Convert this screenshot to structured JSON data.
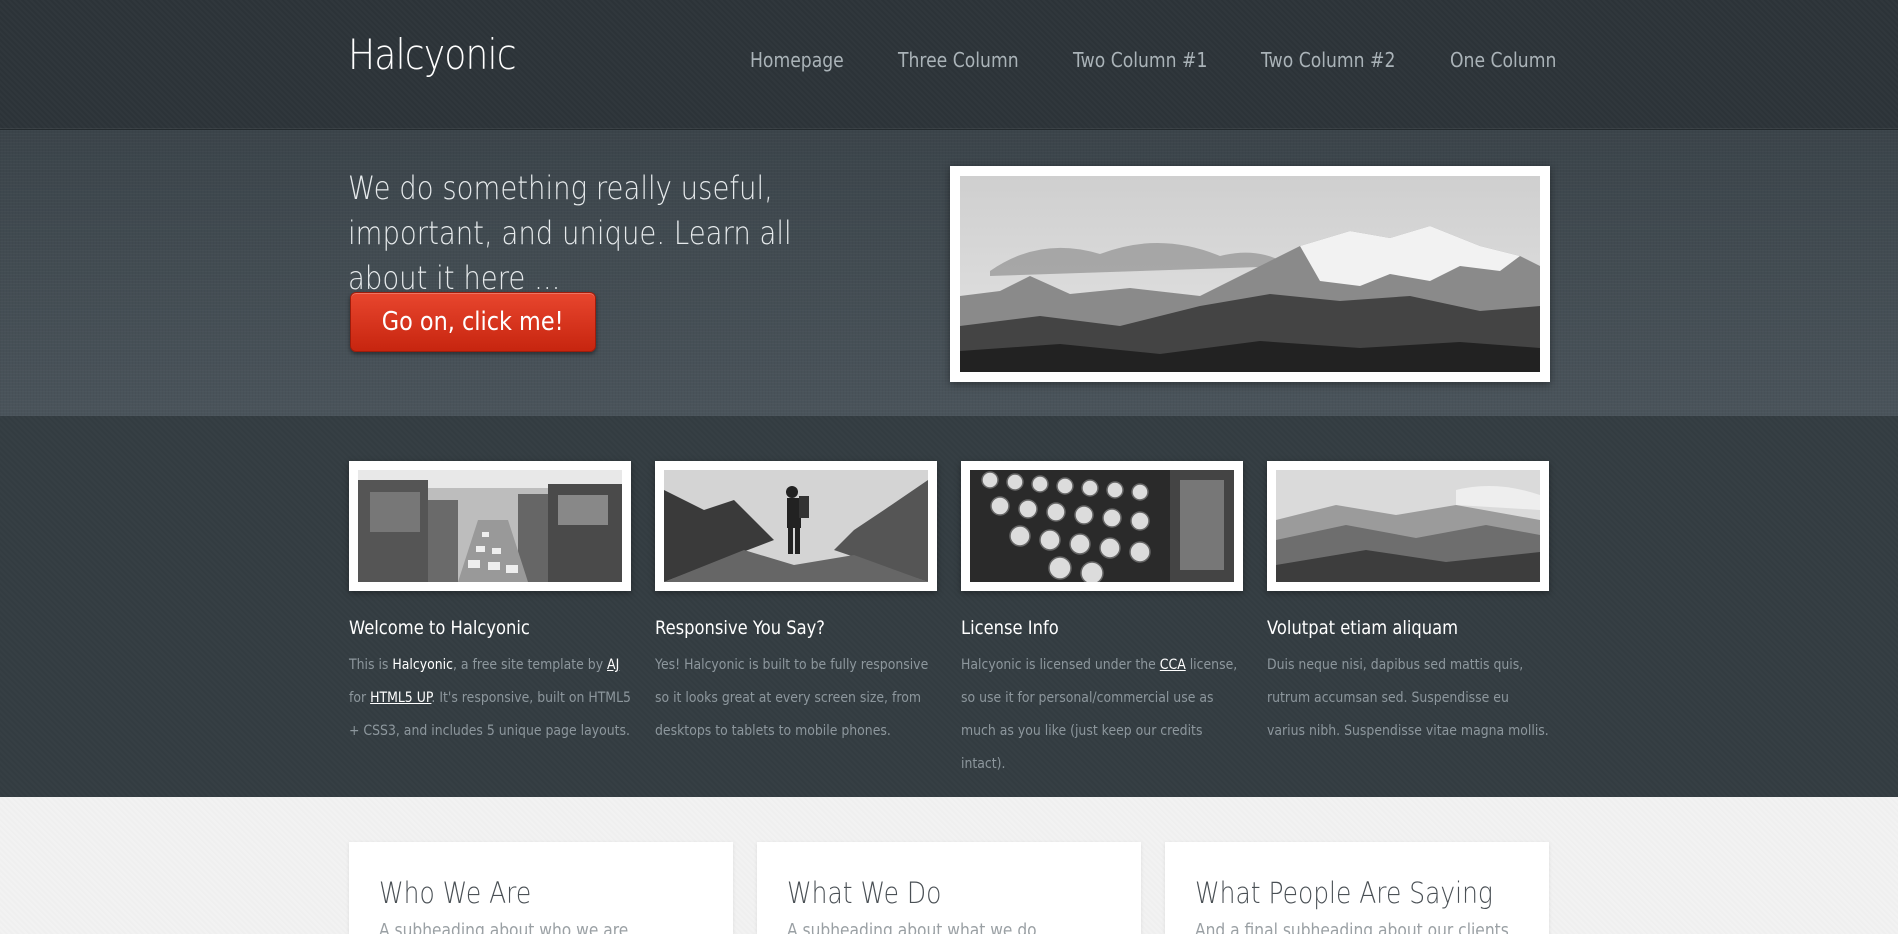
{
  "site": {
    "logo": "Halcyonic"
  },
  "nav": {
    "items": [
      {
        "label": "Homepage"
      },
      {
        "label": "Three Column"
      },
      {
        "label": "Two Column #1"
      },
      {
        "label": "Two Column #2"
      },
      {
        "label": "One Column"
      }
    ]
  },
  "banner": {
    "tagline": "We do something really useful, important, and unique. Learn all about it here ...",
    "cta_label": "Go on, click me!",
    "image": "mountain-landscape"
  },
  "features": [
    {
      "image": "city-traffic-photo",
      "title": "Welcome to Halcyonic",
      "text_1": "This is ",
      "highlight": "Halcyonic",
      "text_2": ", a free site template by ",
      "link_1": "AJ",
      "text_3": " for ",
      "link_2": "HTML5 UP",
      "text_4": ". It's responsive, built on HTML5 + CSS3, and includes 5 unique page layouts."
    },
    {
      "image": "hiker-photo",
      "title": "Responsive You Say?",
      "text": "Yes! Halcyonic is built to be fully responsive so it looks great at every screen size, from desktops to tablets to mobile phones."
    },
    {
      "image": "typewriter-photo",
      "title": "License Info",
      "text_1": "Halcyonic is licensed under the ",
      "link_1": "CCA",
      "text_2": " license, so use it for personal/commercial use as much as you like (just keep our credits intact)."
    },
    {
      "image": "hills-photo",
      "title": "Volutpat etiam aliquam",
      "text": "Duis neque nisi, dapibus sed mattis quis, rutrum accumsan sed. Suspendisse eu varius nibh. Suspendisse vitae magna mollis."
    }
  ],
  "main": {
    "boxes": [
      {
        "title": "Who We Are",
        "subheading": "A subheading about who we are"
      },
      {
        "title": "What We Do",
        "subheading": "A subheading about what we do"
      },
      {
        "title": "What People Are Saying",
        "subheading": "And a final subheading about our clients"
      }
    ]
  },
  "colors": {
    "header_bg": "#2d3439",
    "banner_bg": "#434c52",
    "features_bg": "#343d42",
    "main_bg": "#f2f2f2",
    "accent": "#d8351d"
  }
}
